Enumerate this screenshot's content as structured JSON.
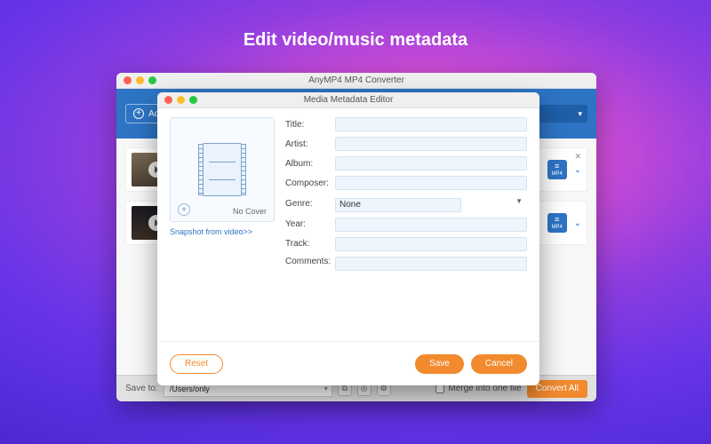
{
  "hero_title": "Edit video/music metadata",
  "colors": {
    "accent_blue": "#2d74c4",
    "accent_orange": "#f28a2e"
  },
  "back_window": {
    "title": "AnyMP4 MP4 Converter",
    "add_files_label": "Add Files",
    "rows": [
      {
        "format": "MP4"
      },
      {
        "format": "MP4"
      }
    ],
    "bottom": {
      "save_to_label": "Save to:",
      "path": "/Users/only",
      "merge_label": "Merge into one file",
      "convert_all_label": "Convert All"
    }
  },
  "modal": {
    "title": "Media Metadata Editor",
    "cover": {
      "no_cover_label": "No Cover",
      "snapshot_label": "Snapshot from video>>"
    },
    "fields": {
      "title_label": "Title:",
      "artist_label": "Artist:",
      "album_label": "Album:",
      "composer_label": "Composer:",
      "genre_label": "Genre:",
      "genre_value": "None",
      "year_label": "Year:",
      "track_label": "Track:",
      "comments_label": "Comments:"
    },
    "buttons": {
      "reset": "Reset",
      "save": "Save",
      "cancel": "Cancel"
    }
  }
}
